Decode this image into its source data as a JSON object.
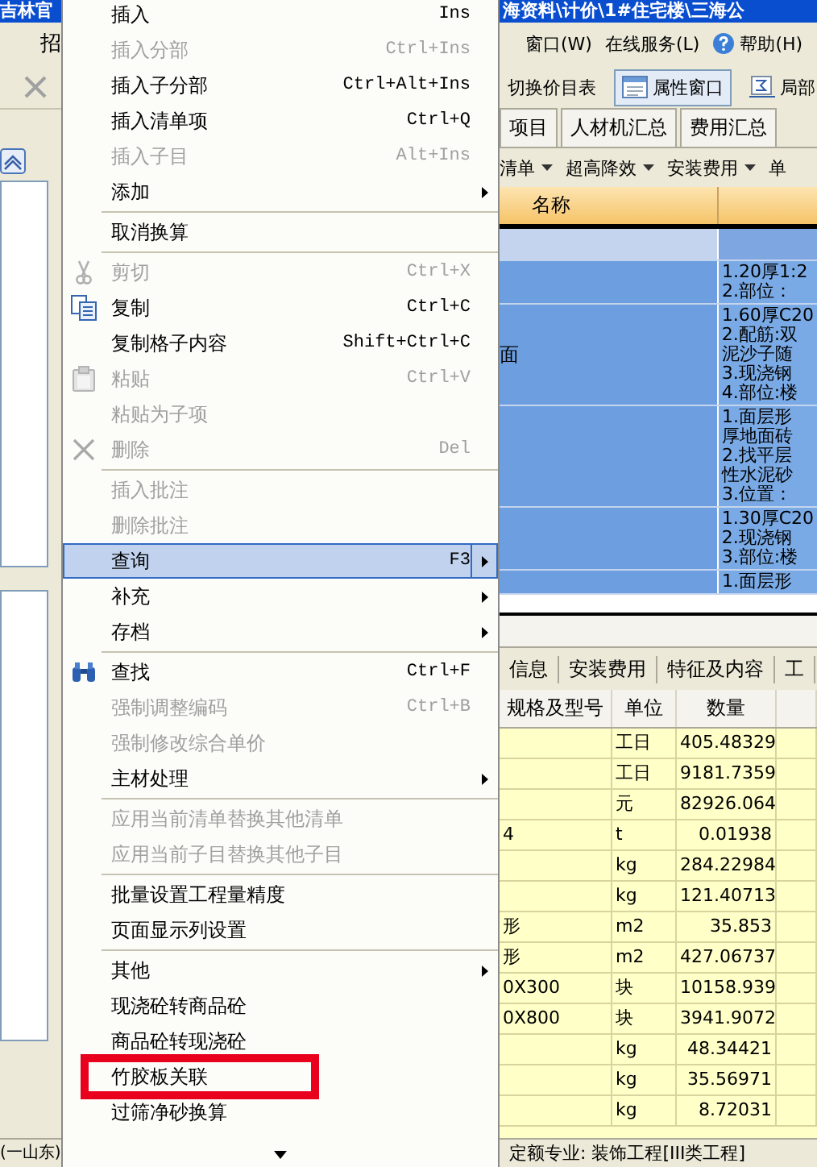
{
  "title_bar": {
    "left_text": "吉林官",
    "right_text": "海资料\\计价\\1#住宅楼\\三海公"
  },
  "menu_bar": {
    "left_item": "招",
    "items": [
      {
        "label": "窗口(W)"
      },
      {
        "label": "在线服务(L)"
      },
      {
        "label": "帮助(H)"
      }
    ]
  },
  "toolbar": {
    "items": [
      {
        "label": "切换价目表",
        "pressed": false
      },
      {
        "label": "属性窗口",
        "pressed": true
      },
      {
        "label": "局部",
        "pressed": false
      }
    ]
  },
  "tabs": [
    {
      "label": "项目",
      "selected": false
    },
    {
      "label": "人材机汇总",
      "selected": false
    },
    {
      "label": "费用汇总",
      "selected": false
    }
  ],
  "sub_toolbar": [
    {
      "label": "清单",
      "dropdown": true
    },
    {
      "label": "超高降效",
      "dropdown": true
    },
    {
      "label": "安装费用",
      "dropdown": true
    },
    {
      "label": "单",
      "dropdown": false
    }
  ],
  "upper_table": {
    "columns": [
      "名称"
    ],
    "rows": [
      {
        "kind": "section",
        "selected": true
      },
      {
        "kind": "item",
        "selected": true,
        "description": [
          "1.20厚1:2",
          "2.部位："
        ]
      },
      {
        "kind": "item",
        "selected": true,
        "name": "面",
        "description": [
          "1.60厚C20",
          "2.配筋:双",
          "泥沙子随",
          "3.现浇钢",
          "4.部位:楼"
        ]
      },
      {
        "kind": "item",
        "selected": true,
        "description": [
          "1.面层形",
          "厚地面砖",
          "2.找平层",
          "性水泥砂",
          "3.位置："
        ]
      },
      {
        "kind": "item",
        "selected": true,
        "description": [
          "1.30厚C20",
          "2.现浇钢",
          "3.部位:楼"
        ]
      },
      {
        "kind": "item",
        "selected": true,
        "description": [
          "1.面层形"
        ]
      }
    ]
  },
  "lower_tabs": [
    {
      "label": "信息",
      "selected": false
    },
    {
      "label": "安装费用",
      "selected": false
    },
    {
      "label": "特征及内容",
      "selected": false
    },
    {
      "label": "工",
      "selected": false
    }
  ],
  "lower_table": {
    "columns": [
      "规格及型号",
      "单位",
      "数量"
    ],
    "rows": [
      {
        "unit": "工日",
        "quantity": "405.48329"
      },
      {
        "unit": "工日",
        "quantity": "9181.7359"
      },
      {
        "unit": "元",
        "quantity": "82926.064"
      },
      {
        "spec": "4",
        "unit": "t",
        "quantity": "0.01938"
      },
      {
        "unit": "kg",
        "quantity": "284.22984"
      },
      {
        "unit": "kg",
        "quantity": "121.40713"
      },
      {
        "spec": "形",
        "unit": "m2",
        "quantity": "35.853"
      },
      {
        "spec": "形",
        "unit": "m2",
        "quantity": "427.06737"
      },
      {
        "spec": "0X300",
        "unit": "块",
        "quantity": "10158.939"
      },
      {
        "spec": "0X800",
        "unit": "块",
        "quantity": "3941.9072"
      },
      {
        "unit": "kg",
        "quantity": "48.34421"
      },
      {
        "unit": "kg",
        "quantity": "35.56971"
      },
      {
        "unit": "kg",
        "quantity": "8.72031"
      }
    ]
  },
  "status_bar": {
    "left": "(一山东)",
    "right": "定额专业: 装饰工程[III类工程]"
  },
  "context_menu": {
    "items": [
      {
        "kind": "item",
        "label": "插入",
        "shortcut": "Ins",
        "disabled": false,
        "submenu": false,
        "selected": false
      },
      {
        "kind": "item",
        "label": "插入分部",
        "shortcut": "Ctrl+Ins",
        "disabled": true,
        "submenu": false,
        "selected": false
      },
      {
        "kind": "item",
        "label": "插入子分部",
        "shortcut": "Ctrl+Alt+Ins",
        "disabled": false,
        "submenu": false,
        "selected": false
      },
      {
        "kind": "item",
        "label": "插入清单项",
        "shortcut": "Ctrl+Q",
        "disabled": false,
        "submenu": false,
        "selected": false
      },
      {
        "kind": "item",
        "label": "插入子目",
        "shortcut": "Alt+Ins",
        "disabled": true,
        "submenu": false,
        "selected": false
      },
      {
        "kind": "item",
        "label": "添加",
        "disabled": false,
        "submenu": true,
        "selected": false
      },
      {
        "kind": "separator"
      },
      {
        "kind": "item",
        "label": "取消换算",
        "disabled": false,
        "submenu": false,
        "selected": false
      },
      {
        "kind": "separator"
      },
      {
        "kind": "item",
        "label": "剪切",
        "shortcut": "Ctrl+X",
        "disabled": true,
        "submenu": false,
        "selected": false
      },
      {
        "kind": "item",
        "label": "复制",
        "shortcut": "Ctrl+C",
        "disabled": false,
        "submenu": false,
        "selected": false
      },
      {
        "kind": "item",
        "label": "复制格子内容",
        "shortcut": "Shift+Ctrl+C",
        "disabled": false,
        "submenu": false,
        "selected": false
      },
      {
        "kind": "item",
        "label": "粘贴",
        "shortcut": "Ctrl+V",
        "disabled": true,
        "submenu": false,
        "selected": false
      },
      {
        "kind": "item",
        "label": "粘贴为子项",
        "disabled": true,
        "submenu": false,
        "selected": false
      },
      {
        "kind": "item",
        "label": "删除",
        "shortcut": "Del",
        "disabled": true,
        "submenu": false,
        "selected": false
      },
      {
        "kind": "separator"
      },
      {
        "kind": "item",
        "label": "插入批注",
        "disabled": true,
        "submenu": false,
        "selected": false
      },
      {
        "kind": "item",
        "label": "删除批注",
        "disabled": true,
        "submenu": false,
        "selected": false
      },
      {
        "kind": "item",
        "label": "查询",
        "shortcut": "F3",
        "disabled": false,
        "submenu": true,
        "selected": true
      },
      {
        "kind": "item",
        "label": "补充",
        "disabled": false,
        "submenu": true,
        "selected": false
      },
      {
        "kind": "item",
        "label": "存档",
        "disabled": false,
        "submenu": true,
        "selected": false
      },
      {
        "kind": "separator"
      },
      {
        "kind": "item",
        "label": "查找",
        "shortcut": "Ctrl+F",
        "disabled": false,
        "submenu": false,
        "selected": false
      },
      {
        "kind": "item",
        "label": "强制调整编码",
        "shortcut": "Ctrl+B",
        "disabled": true,
        "submenu": false,
        "selected": false
      },
      {
        "kind": "item",
        "label": "强制修改综合单价",
        "disabled": true,
        "submenu": false,
        "selected": false
      },
      {
        "kind": "item",
        "label": "主材处理",
        "disabled": false,
        "submenu": true,
        "selected": false
      },
      {
        "kind": "separator"
      },
      {
        "kind": "item",
        "label": "应用当前清单替换其他清单",
        "disabled": true,
        "submenu": false,
        "selected": false
      },
      {
        "kind": "item",
        "label": "应用当前子目替换其他子目",
        "disabled": true,
        "submenu": false,
        "selected": false
      },
      {
        "kind": "separator"
      },
      {
        "kind": "item",
        "label": "批量设置工程量精度",
        "disabled": false,
        "submenu": false,
        "selected": false
      },
      {
        "kind": "item",
        "label": "页面显示列设置",
        "disabled": false,
        "submenu": false,
        "selected": false
      },
      {
        "kind": "separator"
      },
      {
        "kind": "item",
        "label": "其他",
        "disabled": false,
        "submenu": true,
        "selected": false
      },
      {
        "kind": "item",
        "label": "现浇砼转商品砼",
        "disabled": false,
        "submenu": false,
        "selected": false
      },
      {
        "kind": "item",
        "label": "商品砼转现浇砼",
        "disabled": false,
        "submenu": false,
        "selected": false
      },
      {
        "kind": "item",
        "label": "竹胶板关联",
        "disabled": false,
        "submenu": false,
        "selected": false,
        "annotated": true
      },
      {
        "kind": "item",
        "label": "过筛净砂换算",
        "disabled": false,
        "submenu": false,
        "selected": false
      }
    ]
  }
}
